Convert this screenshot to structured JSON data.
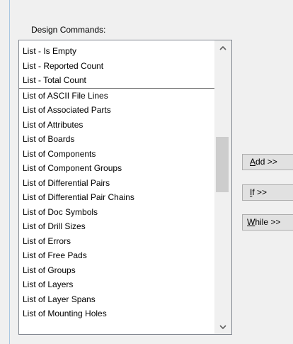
{
  "group_label": "Design Commands:",
  "list_items": [
    "List - Is Empty",
    "List - Reported Count",
    "List - Total Count",
    "List of ASCII File Lines",
    "List of Associated Parts",
    "List of Attributes",
    "List of Boards",
    "List of Components",
    "List of Component Groups",
    "List of Differential Pairs",
    "List of Differential Pair Chains",
    "List of Doc Symbols",
    "List of Drill Sizes",
    "List of Errors",
    "List of Free Pads",
    "List of Groups",
    "List of Layers",
    "List of Layer Spans",
    "List of Mounting Holes"
  ],
  "buttons": {
    "add": {
      "accel": "A",
      "rest": "dd >>"
    },
    "if": {
      "accel": "I",
      "rest": "f >>"
    },
    "while": {
      "accel": "W",
      "rest": "hile >>"
    }
  },
  "icons": {
    "scroll_up": "chevron-up-icon",
    "scroll_down": "chevron-down-icon"
  },
  "scrollbar": {
    "thumb_color": "#cdcdcd"
  }
}
